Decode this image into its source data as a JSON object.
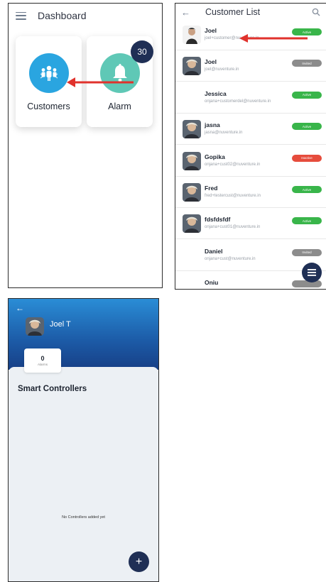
{
  "dashboard": {
    "title": "Dashboard",
    "tiles": [
      {
        "label": "Customers",
        "icon": "people-icon",
        "color": "#2aa5e0"
      },
      {
        "label": "Alarm",
        "icon": "bell-icon",
        "color": "#5fc8b6"
      }
    ],
    "alarm_badge": "30"
  },
  "customer_list": {
    "title": "Customer List",
    "customers": [
      {
        "name": "Joel",
        "email": "joel+customer@nuventure.in",
        "status": "Active",
        "status_color": "#39b54a"
      },
      {
        "name": "Joel",
        "email": "joel@nuventure.in",
        "status": "Invited",
        "status_color": "#8c8c8c"
      },
      {
        "name": "Jessica",
        "email": "onjana+customerdel@nuventure.in",
        "status": "Active",
        "status_color": "#39b54a"
      },
      {
        "name": "jasna",
        "email": "jasna@nuventure.in",
        "status": "Active",
        "status_color": "#39b54a"
      },
      {
        "name": "Gopika",
        "email": "onjana+cust02@nuventure.in",
        "status": "Inactive",
        "status_color": "#e64c3c"
      },
      {
        "name": "Fred",
        "email": "fred+testercust@nuventure.in",
        "status": "Active",
        "status_color": "#39b54a"
      },
      {
        "name": "fdsfdsfdf",
        "email": "onjana+cust01@nuventure.in",
        "status": "Active",
        "status_color": "#39b54a"
      },
      {
        "name": "Daniel",
        "email": "onjana+cust@nuventure.in",
        "status": "Invited",
        "status_color": "#8c8c8c"
      },
      {
        "name": "Oniu",
        "email": "",
        "status": "",
        "status_color": "#8c8c8c"
      }
    ]
  },
  "customer_detail": {
    "name": "Joel T",
    "alarm_count": "0",
    "alarm_label": "Alarms",
    "section_title": "Smart Controllers",
    "empty_message": "No Controllers added yet",
    "add_symbol": "+"
  },
  "colors": {
    "arrow": "#e0322c",
    "navy": "#1f2f55",
    "header_blue": "#2a8dd6"
  }
}
